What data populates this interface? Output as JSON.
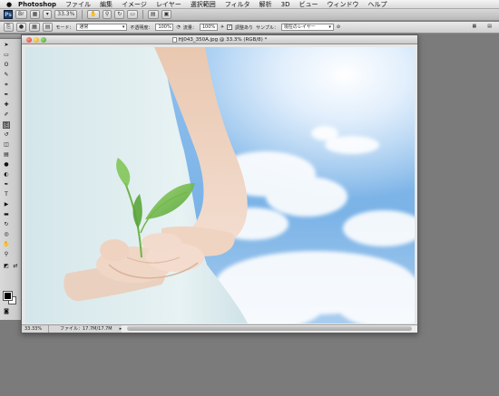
{
  "menubar": {
    "apple": "",
    "items": [
      "Photoshop",
      "ファイル",
      "編集",
      "イメージ",
      "レイヤー",
      "選択範囲",
      "フィルタ",
      "解析",
      "3D",
      "ビュー",
      "ウィンドウ",
      "ヘルプ"
    ]
  },
  "appbar": {
    "logo": "Ps",
    "zoom": "33.3%",
    "icons": [
      "bridge-icon",
      "mini-bridge-icon",
      "view-extras-icon",
      "hand-icon",
      "zoom-icon",
      "rotate-view-icon",
      "ruler-icon",
      "arrange-documents-icon",
      "screen-mode-icon"
    ]
  },
  "options": {
    "mode_label": "モード：",
    "mode_value": "通常",
    "opacity_label": "不透明度：",
    "opacity_value": "100%",
    "flow_label": "流量：",
    "flow_value": "100%",
    "aligned_label": "調整あり",
    "sample_label": "サンプル：",
    "sample_value": "現在のレイヤー"
  },
  "document": {
    "title": "HJ043_350A.jpg @ 33.3% (RGB/8) *",
    "status_zoom": "33.33%",
    "status_info": "ファイル：17.7M/17.7M"
  },
  "colors": {
    "foreground": "#000000",
    "background": "#ffffff",
    "sky": "#7fb6e6"
  }
}
